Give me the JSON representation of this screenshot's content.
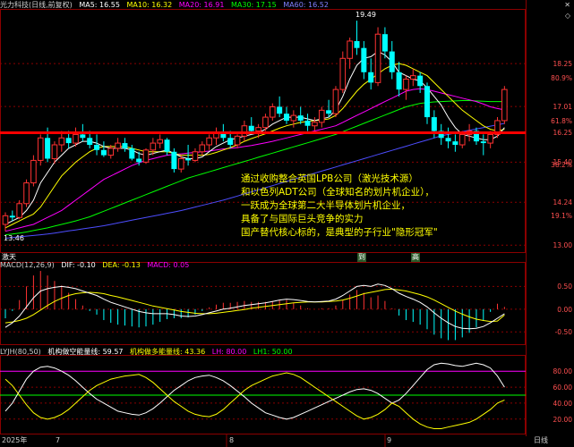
{
  "header": {
    "stock": "光力科技(日线,前复权)",
    "ma5": "MA5: 16.55",
    "ma10": "MA10: 16.32",
    "ma20": "MA20: 16.91",
    "ma30": "MA30: 17.15",
    "ma60": "MA60: 16.52"
  },
  "price_axis": {
    "labels": [
      "19.49",
      "18.25",
      "80.9%",
      "17.01",
      "61.8%",
      "16.25",
      "15.40",
      "38.2%",
      "14.24",
      "19.1%",
      "13.00"
    ],
    "low_label": "13.46",
    "high_label": "19.49"
  },
  "candles": [
    [
      13.6,
      13.95,
      13.4,
      13.85
    ],
    [
      13.85,
      14.0,
      13.7,
      13.8
    ],
    [
      13.8,
      14.3,
      13.75,
      14.2
    ],
    [
      14.2,
      14.9,
      14.1,
      14.8
    ],
    [
      14.8,
      15.6,
      14.7,
      15.45
    ],
    [
      15.45,
      16.2,
      15.3,
      16.1
    ],
    [
      16.1,
      16.4,
      15.4,
      15.5
    ],
    [
      15.5,
      16.0,
      15.35,
      15.9
    ],
    [
      15.9,
      16.3,
      15.7,
      16.1
    ],
    [
      16.1,
      16.3,
      15.8,
      15.95
    ],
    [
      15.95,
      16.4,
      15.85,
      16.2
    ],
    [
      16.2,
      16.5,
      16.0,
      16.1
    ],
    [
      16.1,
      16.3,
      15.8,
      15.9
    ],
    [
      15.9,
      16.2,
      15.6,
      15.75
    ],
    [
      15.75,
      16.0,
      15.55,
      15.6
    ],
    [
      15.6,
      15.9,
      15.5,
      15.8
    ],
    [
      15.8,
      16.1,
      15.7,
      15.95
    ],
    [
      15.95,
      16.1,
      15.7,
      15.8
    ],
    [
      15.8,
      15.9,
      15.45,
      15.5
    ],
    [
      15.5,
      15.7,
      15.3,
      15.4
    ],
    [
      15.4,
      15.8,
      15.35,
      15.75
    ],
    [
      15.75,
      16.1,
      15.6,
      15.95
    ],
    [
      15.95,
      16.2,
      15.8,
      16.05
    ],
    [
      16.05,
      16.1,
      15.6,
      15.7
    ],
    [
      15.7,
      15.8,
      15.1,
      15.2
    ],
    [
      15.2,
      15.6,
      15.1,
      15.5
    ],
    [
      15.5,
      15.9,
      15.3,
      15.45
    ],
    [
      15.45,
      15.8,
      15.4,
      15.7
    ],
    [
      15.7,
      16.0,
      15.6,
      15.9
    ],
    [
      15.9,
      16.2,
      15.75,
      16.1
    ],
    [
      16.1,
      16.4,
      15.9,
      16.25
    ],
    [
      16.25,
      16.5,
      16.0,
      16.1
    ],
    [
      16.1,
      16.3,
      15.8,
      15.9
    ],
    [
      15.9,
      16.2,
      15.8,
      16.15
    ],
    [
      16.15,
      16.6,
      16.0,
      16.45
    ],
    [
      16.45,
      16.7,
      16.2,
      16.3
    ],
    [
      16.3,
      16.5,
      16.1,
      16.4
    ],
    [
      16.4,
      16.8,
      16.3,
      16.7
    ],
    [
      16.7,
      17.1,
      16.6,
      17.0
    ],
    [
      17.0,
      17.3,
      16.7,
      16.8
    ],
    [
      16.8,
      17.0,
      16.5,
      16.6
    ],
    [
      16.6,
      16.9,
      16.4,
      16.75
    ],
    [
      16.75,
      17.0,
      16.5,
      16.6
    ],
    [
      16.6,
      16.8,
      16.3,
      16.45
    ],
    [
      16.45,
      16.7,
      16.3,
      16.55
    ],
    [
      16.55,
      17.0,
      16.4,
      16.9
    ],
    [
      16.9,
      17.2,
      16.7,
      16.8
    ],
    [
      16.8,
      17.6,
      16.7,
      17.5
    ],
    [
      17.5,
      18.6,
      17.4,
      18.4
    ],
    [
      18.4,
      19.0,
      18.1,
      18.9
    ],
    [
      18.9,
      19.49,
      18.5,
      18.7
    ],
    [
      18.7,
      18.9,
      17.8,
      18.0
    ],
    [
      18.0,
      18.4,
      17.5,
      17.7
    ],
    [
      17.7,
      19.3,
      17.6,
      19.1
    ],
    [
      19.1,
      19.3,
      18.4,
      18.6
    ],
    [
      18.6,
      18.9,
      17.8,
      18.0
    ],
    [
      18.0,
      18.3,
      17.3,
      17.5
    ],
    [
      17.5,
      17.9,
      17.2,
      17.8
    ],
    [
      17.8,
      18.1,
      17.6,
      17.9
    ],
    [
      17.9,
      18.0,
      17.4,
      17.6
    ],
    [
      17.6,
      17.7,
      16.5,
      16.7
    ],
    [
      16.7,
      16.9,
      16.1,
      16.3
    ],
    [
      16.3,
      16.5,
      15.9,
      16.1
    ],
    [
      16.1,
      16.4,
      15.8,
      16.0
    ],
    [
      16.0,
      16.2,
      15.7,
      15.9
    ],
    [
      15.9,
      16.3,
      15.8,
      16.2
    ],
    [
      16.2,
      16.5,
      16.0,
      16.3
    ],
    [
      16.3,
      16.4,
      15.9,
      16.0
    ],
    [
      16.0,
      16.2,
      15.6,
      15.95
    ],
    [
      15.95,
      16.3,
      15.8,
      16.2
    ],
    [
      16.2,
      16.7,
      16.1,
      16.6
    ],
    [
      16.6,
      17.6,
      16.5,
      17.5
    ]
  ],
  "ma_lines": {
    "ma5": [
      13.6,
      13.7,
      13.8,
      14.0,
      14.3,
      14.8,
      15.1,
      15.4,
      15.6,
      15.8,
      15.9,
      16.0,
      16.0,
      15.95,
      15.85,
      15.8,
      15.8,
      15.8,
      15.75,
      15.65,
      15.6,
      15.65,
      15.7,
      15.75,
      15.65,
      15.55,
      15.5,
      15.5,
      15.55,
      15.7,
      15.85,
      15.95,
      16.05,
      16.1,
      16.15,
      16.2,
      16.25,
      16.35,
      16.5,
      16.6,
      16.7,
      16.7,
      16.7,
      16.65,
      16.6,
      16.65,
      16.7,
      16.9,
      17.3,
      17.8,
      18.2,
      18.4,
      18.45,
      18.6,
      18.5,
      18.3,
      18.0,
      17.9,
      17.8,
      17.75,
      17.55,
      17.3,
      17.05,
      16.7,
      16.4,
      16.2,
      16.15,
      16.1,
      16.05,
      16.05,
      16.15,
      16.4
    ],
    "ma10": [
      13.5,
      13.6,
      13.7,
      13.8,
      13.9,
      14.1,
      14.4,
      14.7,
      15.0,
      15.2,
      15.4,
      15.55,
      15.7,
      15.8,
      15.85,
      15.85,
      15.85,
      15.85,
      15.8,
      15.75,
      15.7,
      15.7,
      15.7,
      15.7,
      15.65,
      15.6,
      15.6,
      15.6,
      15.6,
      15.62,
      15.68,
      15.75,
      15.82,
      15.9,
      16.0,
      16.08,
      16.15,
      16.22,
      16.3,
      16.38,
      16.45,
      16.5,
      16.55,
      16.58,
      16.6,
      16.62,
      16.65,
      16.75,
      16.95,
      17.2,
      17.45,
      17.65,
      17.8,
      17.95,
      18.1,
      18.2,
      18.25,
      18.2,
      18.1,
      18.0,
      17.9,
      17.7,
      17.5,
      17.3,
      17.1,
      16.9,
      16.75,
      16.6,
      16.45,
      16.35,
      16.3,
      16.35
    ],
    "ma20": [
      13.4,
      13.45,
      13.5,
      13.55,
      13.6,
      13.7,
      13.8,
      13.9,
      14.0,
      14.15,
      14.3,
      14.45,
      14.6,
      14.75,
      14.9,
      15.0,
      15.1,
      15.2,
      15.3,
      15.38,
      15.45,
      15.5,
      15.55,
      15.6,
      15.62,
      15.64,
      15.66,
      15.68,
      15.7,
      15.72,
      15.75,
      15.78,
      15.8,
      15.82,
      15.85,
      15.88,
      15.92,
      15.96,
      16.0,
      16.05,
      16.1,
      16.15,
      16.2,
      16.25,
      16.3,
      16.35,
      16.4,
      16.45,
      16.55,
      16.65,
      16.75,
      16.85,
      16.95,
      17.05,
      17.15,
      17.25,
      17.35,
      17.45,
      17.5,
      17.52,
      17.5,
      17.45,
      17.4,
      17.35,
      17.3,
      17.25,
      17.2,
      17.15,
      17.08,
      17.0,
      16.95,
      16.91
    ],
    "ma30": [
      13.3,
      13.32,
      13.35,
      13.38,
      13.42,
      13.46,
      13.5,
      13.55,
      13.6,
      13.65,
      13.7,
      13.76,
      13.82,
      13.9,
      13.98,
      14.06,
      14.14,
      14.22,
      14.3,
      14.38,
      14.46,
      14.54,
      14.62,
      14.7,
      14.78,
      14.86,
      14.94,
      15.0,
      15.06,
      15.12,
      15.18,
      15.24,
      15.3,
      15.36,
      15.42,
      15.48,
      15.54,
      15.6,
      15.66,
      15.72,
      15.78,
      15.84,
      15.9,
      15.96,
      16.02,
      16.08,
      16.14,
      16.2,
      16.28,
      16.36,
      16.44,
      16.52,
      16.6,
      16.68,
      16.76,
      16.84,
      16.92,
      17.0,
      17.05,
      17.1,
      17.12,
      17.14,
      17.15,
      17.16,
      17.17,
      17.18,
      17.18,
      17.17,
      17.16,
      17.15,
      17.15,
      17.15
    ],
    "ma60": [
      13.2,
      13.22,
      13.24,
      13.26,
      13.28,
      13.3,
      13.32,
      13.35,
      13.38,
      13.41,
      13.44,
      13.47,
      13.5,
      13.53,
      13.56,
      13.6,
      13.64,
      13.68,
      13.72,
      13.76,
      13.8,
      13.84,
      13.88,
      13.92,
      13.96,
      14.0,
      14.05,
      14.1,
      14.15,
      14.2,
      14.25,
      14.3,
      14.36,
      14.42,
      14.48,
      14.54,
      14.6,
      14.66,
      14.72,
      14.78,
      14.84,
      14.9,
      14.96,
      15.02,
      15.08,
      15.14,
      15.2,
      15.26,
      15.32,
      15.38,
      15.44,
      15.5,
      15.56,
      15.62,
      15.68,
      15.74,
      15.8,
      15.86,
      15.92,
      15.98,
      16.04,
      16.1,
      16.16,
      16.2,
      16.24,
      16.28,
      16.32,
      16.36,
      16.4,
      16.44,
      16.48,
      16.52
    ]
  },
  "hline_price": 16.25,
  "annotation": {
    "lines": [
      "通过收购整合英国LPB公司（激光技术源）",
      "和以色列ADT公司（全球知名的划片机企业），",
      "一跃成为全球第二大半导体划片机企业，",
      "具备了与国际巨头竞争的实力",
      "国产替代核心标的，是典型的子行业\"隐形冠军\""
    ]
  },
  "macd": {
    "title": "MACD(12,26,9)",
    "dif": "DIF: -0.10",
    "dea": "DEA: -0.13",
    "macd": "MACD: 0.05",
    "axis": [
      "0.50",
      "0.00",
      "-0.50"
    ],
    "dif_values": [
      -0.4,
      -0.3,
      -0.15,
      0.05,
      0.25,
      0.4,
      0.45,
      0.48,
      0.5,
      0.48,
      0.45,
      0.4,
      0.35,
      0.3,
      0.22,
      0.15,
      0.1,
      0.05,
      0.0,
      -0.05,
      -0.08,
      -0.1,
      -0.1,
      -0.1,
      -0.12,
      -0.15,
      -0.16,
      -0.15,
      -0.12,
      -0.08,
      -0.04,
      0.0,
      0.02,
      0.05,
      0.08,
      0.1,
      0.12,
      0.14,
      0.17,
      0.2,
      0.22,
      0.21,
      0.19,
      0.17,
      0.16,
      0.17,
      0.18,
      0.22,
      0.3,
      0.4,
      0.5,
      0.52,
      0.5,
      0.55,
      0.52,
      0.45,
      0.35,
      0.28,
      0.22,
      0.15,
      0.05,
      -0.08,
      -0.2,
      -0.3,
      -0.38,
      -0.42,
      -0.43,
      -0.42,
      -0.38,
      -0.3,
      -0.2,
      -0.1
    ],
    "dea_values": [
      -0.3,
      -0.28,
      -0.25,
      -0.2,
      -0.12,
      -0.02,
      0.08,
      0.17,
      0.24,
      0.3,
      0.34,
      0.36,
      0.37,
      0.36,
      0.34,
      0.3,
      0.27,
      0.23,
      0.19,
      0.15,
      0.11,
      0.07,
      0.04,
      0.01,
      -0.02,
      -0.05,
      -0.07,
      -0.09,
      -0.1,
      -0.1,
      -0.09,
      -0.07,
      -0.05,
      -0.03,
      -0.01,
      0.02,
      0.04,
      0.06,
      0.08,
      0.1,
      0.12,
      0.14,
      0.15,
      0.16,
      0.16,
      0.16,
      0.17,
      0.18,
      0.2,
      0.24,
      0.29,
      0.34,
      0.37,
      0.4,
      0.43,
      0.44,
      0.42,
      0.4,
      0.36,
      0.32,
      0.27,
      0.2,
      0.12,
      0.04,
      -0.04,
      -0.11,
      -0.17,
      -0.22,
      -0.25,
      -0.27,
      -0.26,
      -0.13
    ],
    "bar_values": [
      -0.2,
      -0.04,
      0.2,
      0.5,
      0.74,
      0.84,
      0.74,
      0.62,
      0.52,
      0.36,
      0.22,
      0.08,
      -0.04,
      -0.12,
      -0.24,
      -0.3,
      -0.34,
      -0.36,
      -0.38,
      -0.4,
      -0.38,
      -0.34,
      -0.28,
      -0.22,
      -0.2,
      -0.2,
      -0.18,
      -0.12,
      -0.04,
      0.04,
      0.1,
      0.14,
      0.14,
      0.16,
      0.18,
      0.16,
      0.16,
      0.16,
      0.18,
      0.2,
      0.2,
      0.14,
      0.08,
      0.02,
      0.0,
      0.02,
      0.02,
      0.08,
      0.2,
      0.32,
      0.42,
      0.36,
      0.26,
      0.3,
      0.18,
      0.02,
      -0.14,
      -0.24,
      -0.28,
      -0.34,
      -0.44,
      -0.56,
      -0.64,
      -0.68,
      -0.68,
      -0.62,
      -0.52,
      -0.4,
      -0.26,
      -0.06,
      0.12,
      0.05
    ]
  },
  "lyjh": {
    "title": "LYJH(80,50)",
    "long_short": "机构做空能量线: 59.57",
    "long": "机构做多能量线: 43.36",
    "lh": "LH: 80.00",
    "lh1": "LH1: 50.00",
    "axis": [
      "80.00",
      "60.00",
      "40.00",
      "20.00"
    ],
    "line_a": [
      30,
      40,
      55,
      70,
      80,
      85,
      86,
      84,
      80,
      75,
      68,
      60,
      52,
      45,
      40,
      35,
      30,
      28,
      26,
      25,
      28,
      33,
      40,
      48,
      56,
      62,
      68,
      72,
      74,
      75,
      72,
      68,
      62,
      55,
      48,
      40,
      34,
      28,
      25,
      22,
      20,
      22,
      26,
      30,
      34,
      38,
      42,
      46,
      50,
      54,
      57,
      58,
      56,
      52,
      46,
      40,
      44,
      52,
      62,
      72,
      82,
      88,
      90,
      89,
      87,
      86,
      88,
      90,
      88,
      84,
      74,
      60
    ],
    "line_b": [
      70,
      62,
      50,
      38,
      28,
      22,
      20,
      22,
      26,
      32,
      40,
      48,
      56,
      62,
      66,
      70,
      72,
      74,
      75,
      76,
      72,
      66,
      58,
      50,
      42,
      36,
      30,
      26,
      24,
      23,
      26,
      32,
      40,
      48,
      56,
      62,
      66,
      70,
      74,
      76,
      78,
      76,
      72,
      66,
      60,
      54,
      48,
      42,
      36,
      30,
      24,
      20,
      22,
      26,
      32,
      40,
      36,
      28,
      20,
      14,
      10,
      8,
      8,
      10,
      12,
      14,
      16,
      20,
      26,
      32,
      40,
      44
    ]
  },
  "footer": {
    "year": "2025年",
    "m7": "7",
    "m8": "8",
    "m9": "9",
    "period": "日线"
  },
  "misc": {
    "ji_tian": "激天",
    "marker_a": "到",
    "marker_b": "高"
  },
  "colors": {
    "up": "#ff3232",
    "down": "#00ffff",
    "ma5": "#ffffff",
    "ma10": "#ffff00",
    "ma20": "#ff00ff",
    "ma30": "#00ff00",
    "ma60": "#4d4dff",
    "hline": "#ff0000",
    "grid": "#8b0000",
    "axis_text": "#ff5050"
  },
  "icons": [
    "close-icon",
    "expand-icon"
  ]
}
